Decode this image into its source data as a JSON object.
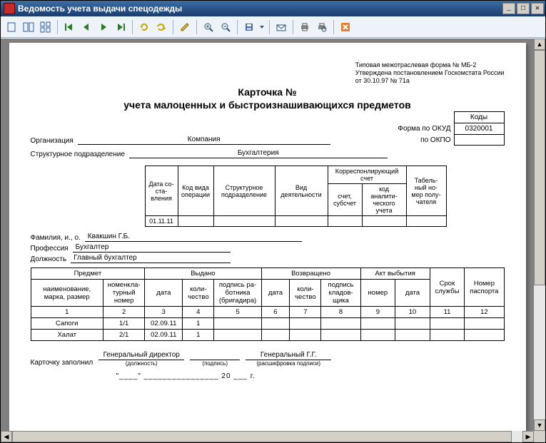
{
  "window": {
    "title": "Ведомость учета выдачи спецодежды"
  },
  "form_ref": {
    "l1": "Типовая межотраслевая форма № МБ-2",
    "l2": "Утверждена постановлением Госкомстата России",
    "l3": "от 30.10.97 № 71а"
  },
  "doc_title": {
    "l1": "Карточка  №",
    "l2": "учета малоценных и быстроизнашивающихся предметов"
  },
  "codes": {
    "head": "Коды",
    "okud_label": "Форма по ОКУД",
    "okud_value": "0320001",
    "okpo_label": "по ОКПО",
    "okpo_value": ""
  },
  "org": {
    "label": "Организация",
    "value": "Компания"
  },
  "dept": {
    "label": "Структурное подразделение",
    "value": "Бухгалтерия"
  },
  "small_headers": {
    "c1": "Дата со-\nста-\nвления",
    "c2": "Код вида\nоперации",
    "c3": "Структурное\nподразделение",
    "c4": "Вид\nдеятельности",
    "c5": "Корреспонлирующий\nсчет",
    "c5a": "счет,\nсубсчет",
    "c5b": "код аналити-\nческого учета",
    "c6": "Табель-\nный но-\nмер полу-\nчателя"
  },
  "small_row": {
    "date": "01.11.11"
  },
  "person": {
    "fio_label": "Фамилия, и., о.",
    "fio_value": "Квакшин Г.Б.",
    "prof_label": "Профессия",
    "prof_value": "Бухгалтер",
    "post_label": "Должность",
    "post_value": "Главный бухгалтер"
  },
  "main_headers": {
    "g1": "Предмет",
    "g1a": "наименование,\nмарка, размер",
    "g1b": "номенкла-\nтурный\nномер",
    "g2": "Выдано",
    "g2a": "дата",
    "g2b": "коли-\nчество",
    "g2c": "подпись ра-\nботника\n(бригадира)",
    "g3": "Возвращено",
    "g3a": "дата",
    "g3b": "коли-\nчество",
    "g3c": "подпись\nкладов-\nщика",
    "g4": "Акт выбытия",
    "g4a": "номер",
    "g4b": "дата",
    "g5": "Срок\nслужбы",
    "g6": "Номер\nпаспорта"
  },
  "colnums": [
    "1",
    "2",
    "3",
    "4",
    "5",
    "6",
    "7",
    "8",
    "9",
    "10",
    "11",
    "12"
  ],
  "rows": [
    {
      "name": "Сапоги",
      "nom": "1/1",
      "date": "02.09.11",
      "qty": "1"
    },
    {
      "name": "Халат",
      "nom": "2/1",
      "date": "02.09.11",
      "qty": "1"
    }
  ],
  "footer": {
    "label": "Карточку заполнил",
    "post": "Генеральный директор",
    "post_cap": "(должность)",
    "sign_cap": "(подпись)",
    "name": "Генеральный Г.Г.",
    "name_cap": "(расшифровка подписи)",
    "dateline": "\"____\" ________________ 20 ___ г."
  }
}
